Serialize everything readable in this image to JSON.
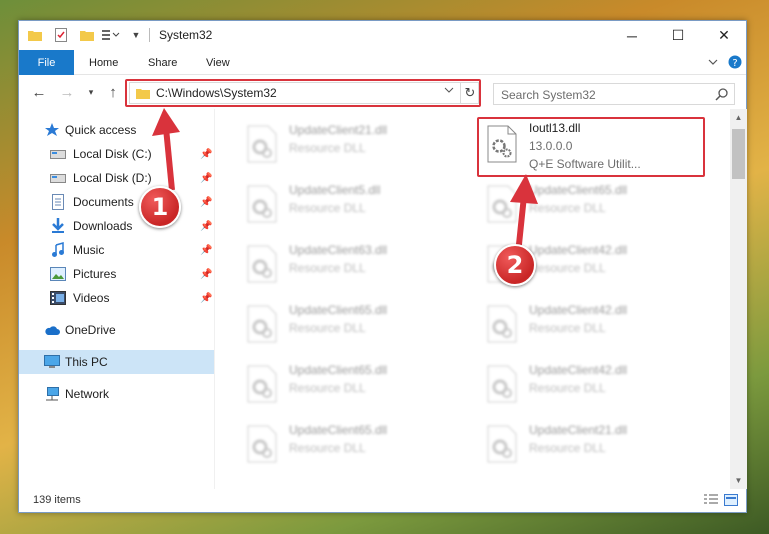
{
  "window": {
    "title": "System32",
    "controls": {
      "minimize": "─",
      "maximize": "☐",
      "close": "✕"
    }
  },
  "ribbon": {
    "tabs": [
      "File",
      "Home",
      "Share",
      "View"
    ],
    "collapse_icon": "chevron-down",
    "help_icon": "?"
  },
  "address_bar": {
    "path": "C:\\Windows\\System32",
    "search_placeholder": "Search System32"
  },
  "sidebar": {
    "items": [
      {
        "label": "Quick access",
        "icon": "star-icon",
        "pinned": false
      },
      {
        "label": "Local Disk (C:)",
        "icon": "drive-icon",
        "pinned": true
      },
      {
        "label": "Local Disk (D:)",
        "icon": "drive-icon",
        "pinned": true
      },
      {
        "label": "Documents",
        "icon": "documents-icon",
        "pinned": true
      },
      {
        "label": "Downloads",
        "icon": "download-icon",
        "pinned": true
      },
      {
        "label": "Music",
        "icon": "music-icon",
        "pinned": true
      },
      {
        "label": "Pictures",
        "icon": "pictures-icon",
        "pinned": true
      },
      {
        "label": "Videos",
        "icon": "videos-icon",
        "pinned": true
      },
      {
        "label": "OneDrive",
        "icon": "cloud-icon",
        "pinned": false
      },
      {
        "label": "This PC",
        "icon": "computer-icon",
        "pinned": false,
        "selected": true
      },
      {
        "label": "Network",
        "icon": "network-icon",
        "pinned": false
      }
    ]
  },
  "files": {
    "left_column": [
      {
        "name": "UpdateClient21.dll",
        "type": "Resource DLL"
      },
      {
        "name": "UpdateClient5.dll",
        "type": "Resource DLL"
      },
      {
        "name": "UpdateClient63.dll",
        "type": "Resource DLL"
      },
      {
        "name": "UpdateClient65.dll",
        "type": "Resource DLL"
      },
      {
        "name": "UpdateClient65.dll",
        "type": "Resource DLL"
      },
      {
        "name": "UpdateClient65.dll",
        "type": "Resource DLL"
      }
    ],
    "right_column": [
      {
        "name": "Ioutl13.dll",
        "version": "13.0.0.0",
        "company": "Q+E Software Utilit..."
      },
      {
        "name": "UpdateClient65.dll",
        "type": "Resource DLL"
      },
      {
        "name": "UpdateClient42.dll",
        "type": "Resource DLL"
      },
      {
        "name": "UpdateClient42.dll",
        "type": "Resource DLL"
      },
      {
        "name": "UpdateClient42.dll",
        "type": "Resource DLL"
      },
      {
        "name": "UpdateClient21.dll",
        "type": "Resource DLL"
      }
    ]
  },
  "status": {
    "item_count": "139 items"
  },
  "callouts": {
    "step1": "1",
    "step2": "2"
  },
  "colors": {
    "accent": "#1979ca",
    "highlight": "#d9333c",
    "selected": "#cce4f7"
  }
}
